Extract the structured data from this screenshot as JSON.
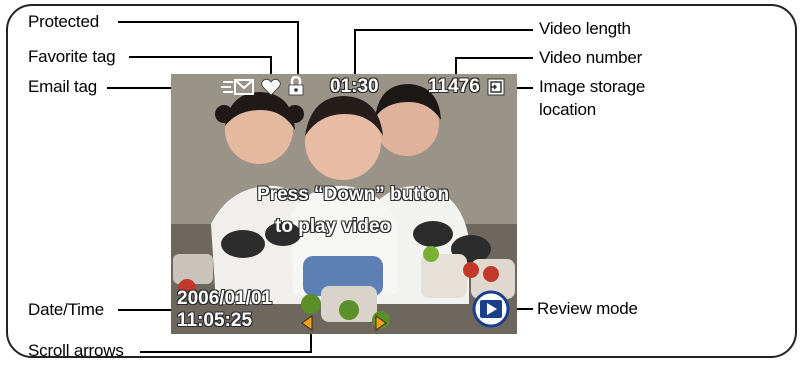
{
  "labels": {
    "protected": "Protected",
    "favorite_tag": "Favorite tag",
    "email_tag": "Email tag",
    "date_time": "Date/Time",
    "scroll_arrows": "Scroll arrows",
    "video_length": "Video length",
    "video_number": "Video number",
    "image_storage_line1": "Image storage",
    "image_storage_line2": "location",
    "review_mode": "Review mode"
  },
  "screen": {
    "video_length": "01:30",
    "video_number": "11476",
    "message_line1": "Press “Down” button",
    "message_line2": "to play video",
    "date": "2006/01/01",
    "time": "11:05:25"
  },
  "icons": [
    "email-icon",
    "heart-icon",
    "lock-icon",
    "storage-card-icon",
    "play-icon",
    "scroll-left-arrow-icon",
    "scroll-right-arrow-icon"
  ],
  "colors": {
    "overlay_text": "#ffffff",
    "scroll_arrow": "#f2a21a",
    "review_icon": "#1c3f8c"
  }
}
